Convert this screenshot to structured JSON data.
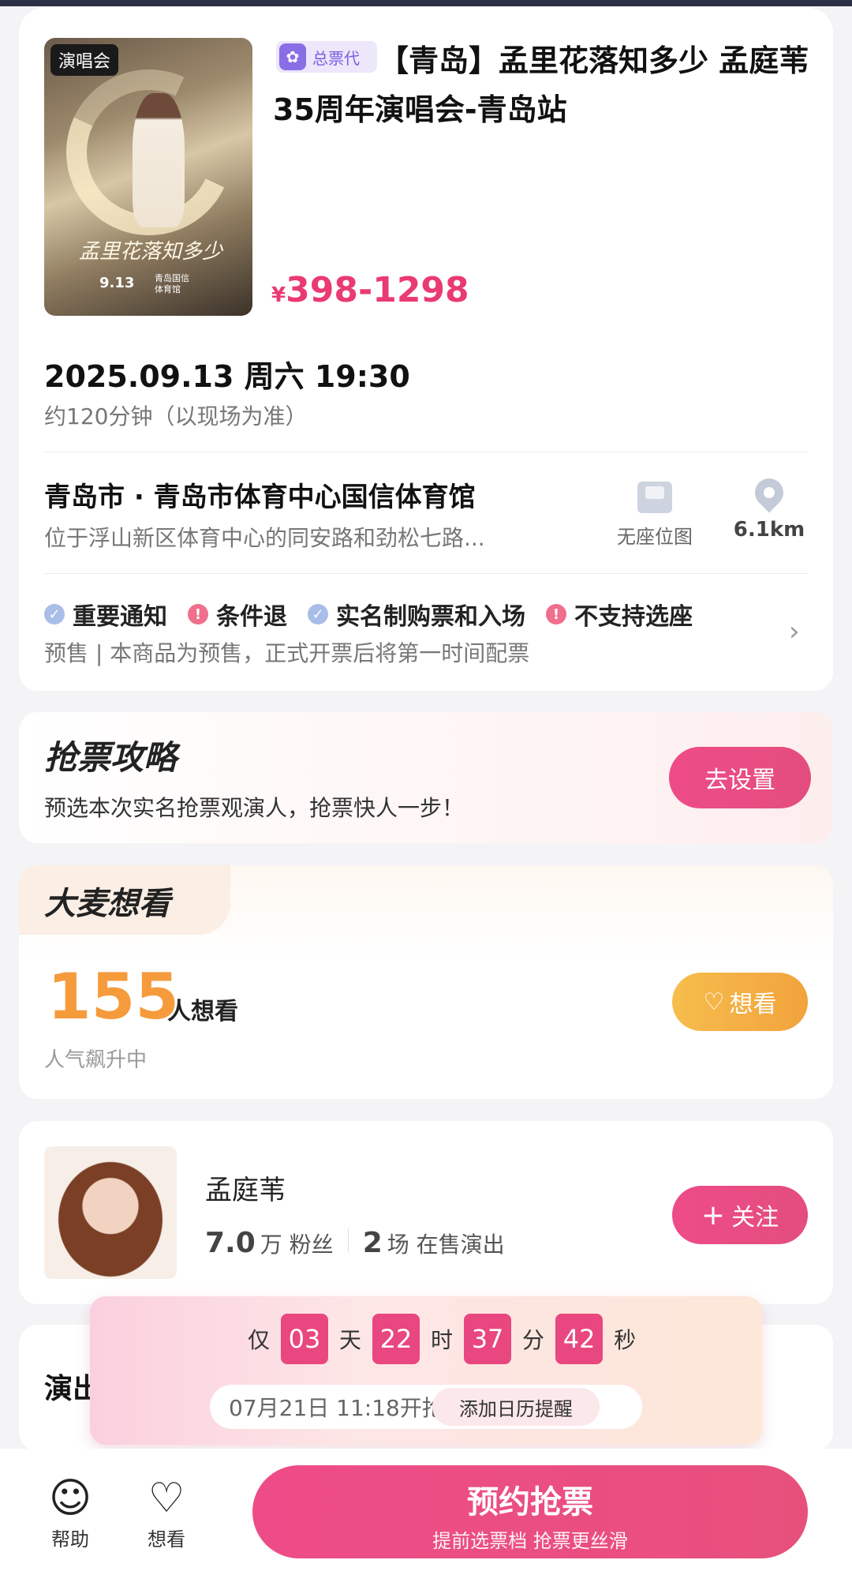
{
  "event": {
    "poster_tag": "演唱会",
    "poster_art_text": "孟里花落知多少",
    "poster_date": "9.13",
    "poster_venue": "青岛国信\n体育馆",
    "agent_badge": "总票代",
    "title": "【青岛】孟里花落知多少 孟庭苇35周年演唱会-青岛站",
    "price_symbol": "¥",
    "price": "398-1298",
    "datetime": "2025.09.13 周六 19:30",
    "duration": "约120分钟（以现场为准）"
  },
  "venue": {
    "name": "青岛市 · 青岛市体育中心国信体育馆",
    "address": "位于浮山新区体育中心的同安路和劲松七路...",
    "seat_map_label": "无座位图",
    "distance": "6.1km"
  },
  "notices": {
    "items": [
      {
        "label": "重要通知",
        "icon": "check",
        "color": "blue"
      },
      {
        "label": "条件退",
        "icon": "!",
        "color": "red"
      },
      {
        "label": "实名制购票和入场",
        "icon": "check",
        "color": "blue"
      },
      {
        "label": "不支持选座",
        "icon": "!",
        "color": "red"
      }
    ],
    "presale_text": "预售 | 本商品为预售，正式开票后将第一时间配票"
  },
  "strategy": {
    "title": "抢票攻略",
    "subtitle": "预选本次实名抢票观演人，抢票快人一步！",
    "button": "去设置"
  },
  "want": {
    "title": "大麦想看",
    "count": "155",
    "unit": "人想看",
    "trend": "人气飙升中",
    "button": "想看"
  },
  "artist": {
    "name": "孟庭苇",
    "fans_value": "7.0",
    "fans_unit": "万 粉丝",
    "shows_value": "2",
    "shows_unit": "场 在售演出",
    "follow_button": "关注"
  },
  "performance": {
    "title": "演出"
  },
  "countdown": {
    "prefix": "仅",
    "days": "03",
    "days_label": "天",
    "hours": "22",
    "hours_label": "时",
    "minutes": "37",
    "minutes_label": "分",
    "seconds": "42",
    "seconds_label": "秒",
    "open_time": "07月21日 11:18开抢",
    "remind_button": "添加日历提醒"
  },
  "bottom_bar": {
    "help_label": "帮助",
    "want_label": "想看",
    "book_main": "预约抢票",
    "book_sub": "提前选票档 抢票更丝滑"
  }
}
